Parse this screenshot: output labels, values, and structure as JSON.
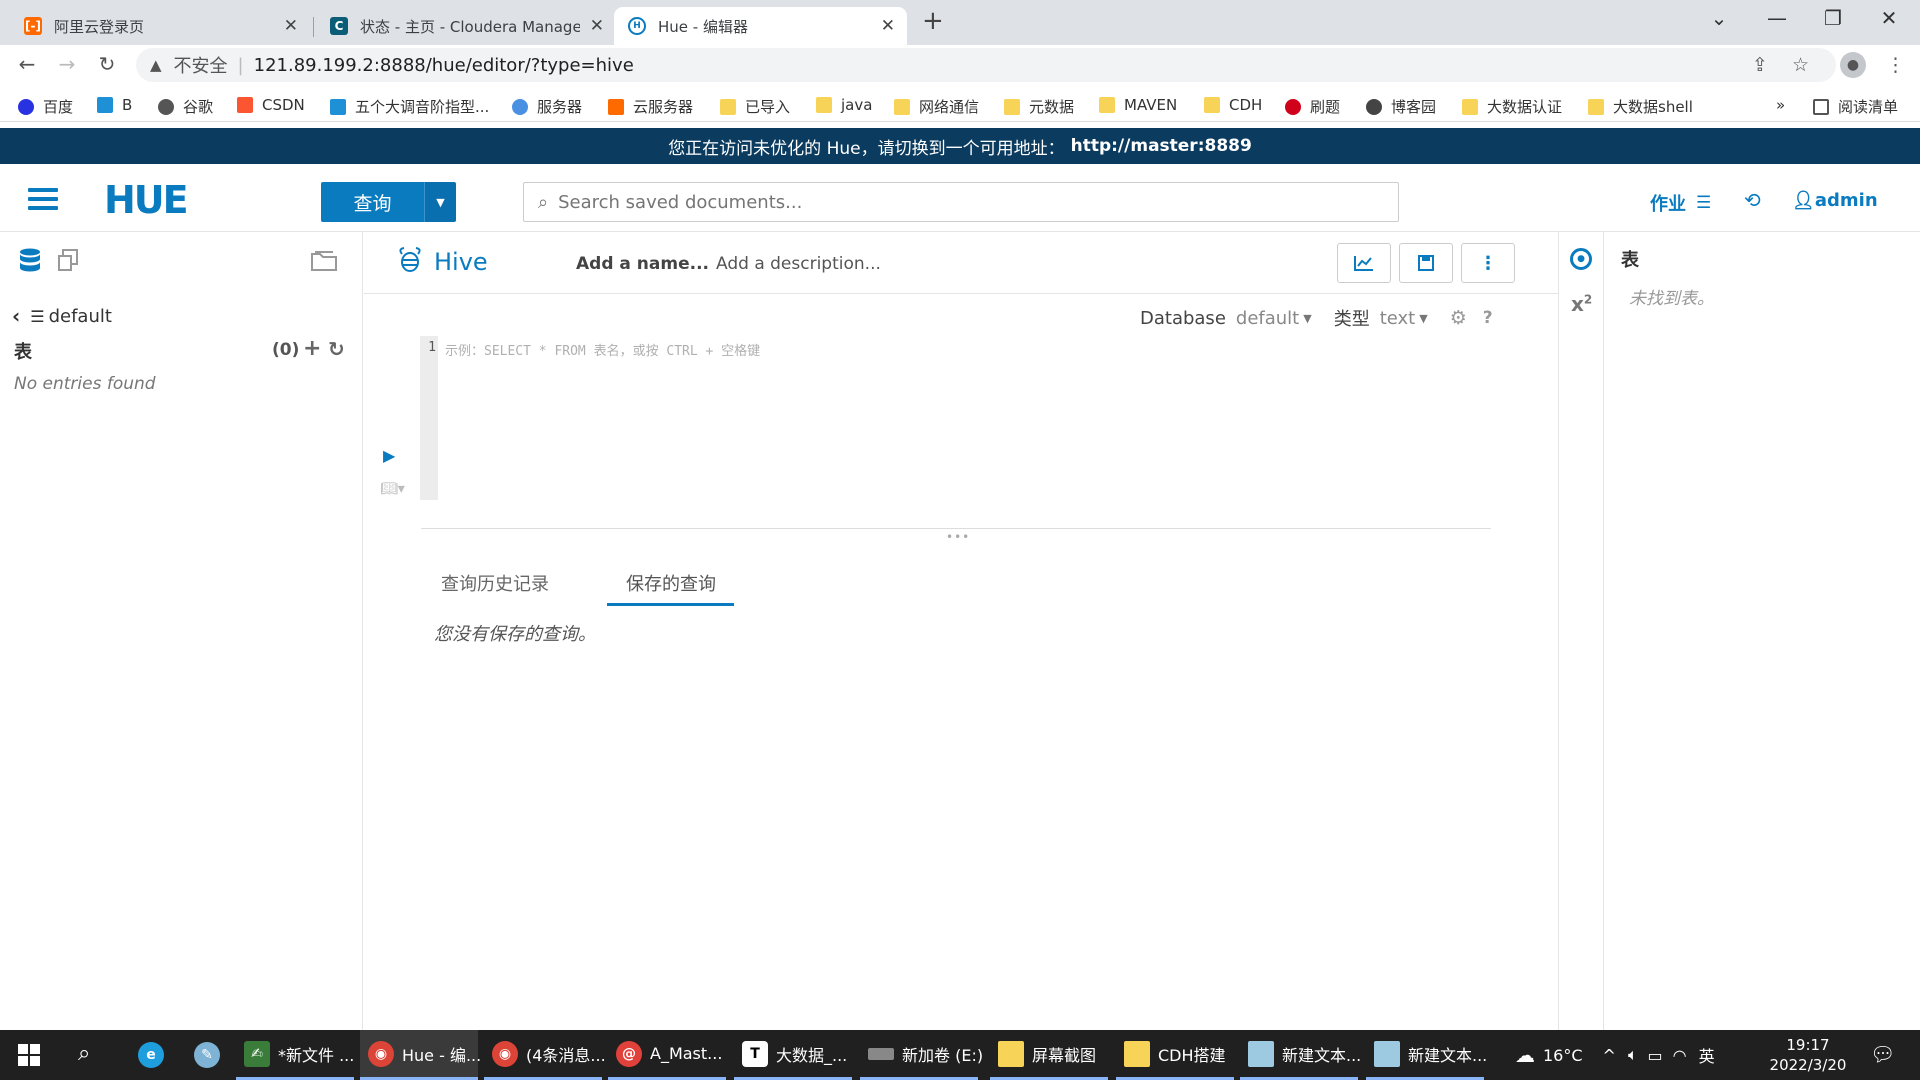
{
  "browser": {
    "tabs": [
      {
        "title": "阿里云登录页"
      },
      {
        "title": "状态 - 主页 - Cloudera Manage"
      },
      {
        "title": "Hue - 编辑器"
      }
    ],
    "insecure_label": "不安全",
    "url": "121.89.199.2:8888/hue/editor/?type=hive",
    "bookmarks": [
      {
        "label": "百度"
      },
      {
        "label": "B"
      },
      {
        "label": "谷歌"
      },
      {
        "label": "CSDN"
      },
      {
        "label": "五个大调音阶指型..."
      },
      {
        "label": "服务器"
      },
      {
        "label": "云服务器"
      },
      {
        "label": "已导入"
      },
      {
        "label": "java"
      },
      {
        "label": "网络通信"
      },
      {
        "label": "元数据"
      },
      {
        "label": "MAVEN"
      },
      {
        "label": "CDH"
      },
      {
        "label": "刷题"
      },
      {
        "label": "博客园"
      },
      {
        "label": "大数据认证"
      },
      {
        "label": "大数据shell"
      }
    ],
    "more_bookmarks": "»",
    "reading_list": "阅读清单"
  },
  "banner": {
    "text": "您正在访问未优化的 Hue，请切换到一个可用地址：",
    "link": "http://master:8889"
  },
  "header": {
    "logo": "HUE",
    "query_button": "查询",
    "search_placeholder": "Search saved documents...",
    "jobs": "作业",
    "user": "admin"
  },
  "left_panel": {
    "database": "default",
    "tables_label": "表",
    "table_count": "(0)",
    "empty_text": "No entries found"
  },
  "editor": {
    "type": "Hive",
    "name_placeholder": "Add a name...",
    "description_placeholder": "Add a description...",
    "database_label": "Database",
    "database_value": "default",
    "type_label": "类型",
    "type_value": "text",
    "line_number": "1",
    "placeholder": "示例：SELECT * FROM 表名，或按 CTRL + 空格键",
    "tabs": [
      {
        "label": "查询历史记录"
      },
      {
        "label": "保存的查询"
      }
    ],
    "no_saved": "您没有保存的查询。"
  },
  "assist": {
    "title": "表",
    "empty": "未找到表。"
  },
  "taskbar": {
    "apps": [
      {
        "label": "*新文件 ..."
      },
      {
        "label": "Hue - 编..."
      },
      {
        "label": "(4条消息..."
      },
      {
        "label": "A_Mast..."
      },
      {
        "label": "大数据_..."
      },
      {
        "label": "新加卷 (E:)"
      },
      {
        "label": "屏幕截图"
      },
      {
        "label": "CDH搭建"
      },
      {
        "label": "新建文本..."
      },
      {
        "label": "新建文本..."
      }
    ],
    "temperature": "16°C",
    "ime": "英",
    "time": "19:17",
    "date": "2022/3/20"
  },
  "colors": {
    "hue_blue": "#0b7bc0",
    "banner": "#0b3b5f",
    "taskbar": "#202020"
  }
}
